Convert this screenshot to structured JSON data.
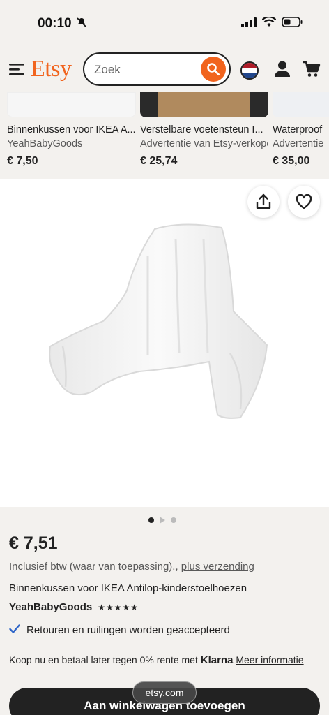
{
  "status_bar": {
    "time": "00:10"
  },
  "header": {
    "logo": "Etsy",
    "search_placeholder": "Zoek"
  },
  "related": [
    {
      "title": "Binnenkussen voor IKEA A...",
      "shop": "YeahBabyGoods",
      "price": "€ 7,50"
    },
    {
      "title": "Verstelbare voetensteun I...",
      "shop": "Advertentie van Etsy-verkoper",
      "price": "€ 25,74"
    },
    {
      "title": "Waterproof",
      "shop": "Advertentie",
      "price": "€ 35,00"
    }
  ],
  "product": {
    "price": "€ 7,51",
    "vat_text": "Inclusief btw (waar van toepassing).,",
    "shipping_link": "plus verzending",
    "title": "Binnenkussen voor IKEA Antilop-kinderstoelhoezen",
    "seller": "YeahBabyGoods",
    "rating_stars": 5,
    "returns": "Retouren en ruilingen worden geaccepteerd",
    "klarna_prefix": "Koop nu en betaal later tegen 0% rente met",
    "klarna_brand": "Klarna",
    "klarna_link": "Meer informatie"
  },
  "cta_label": "Aan winkelwagen toevoegen",
  "browser_url": "etsy.com",
  "colors": {
    "brand": "#f1641e",
    "dark": "#222222"
  }
}
